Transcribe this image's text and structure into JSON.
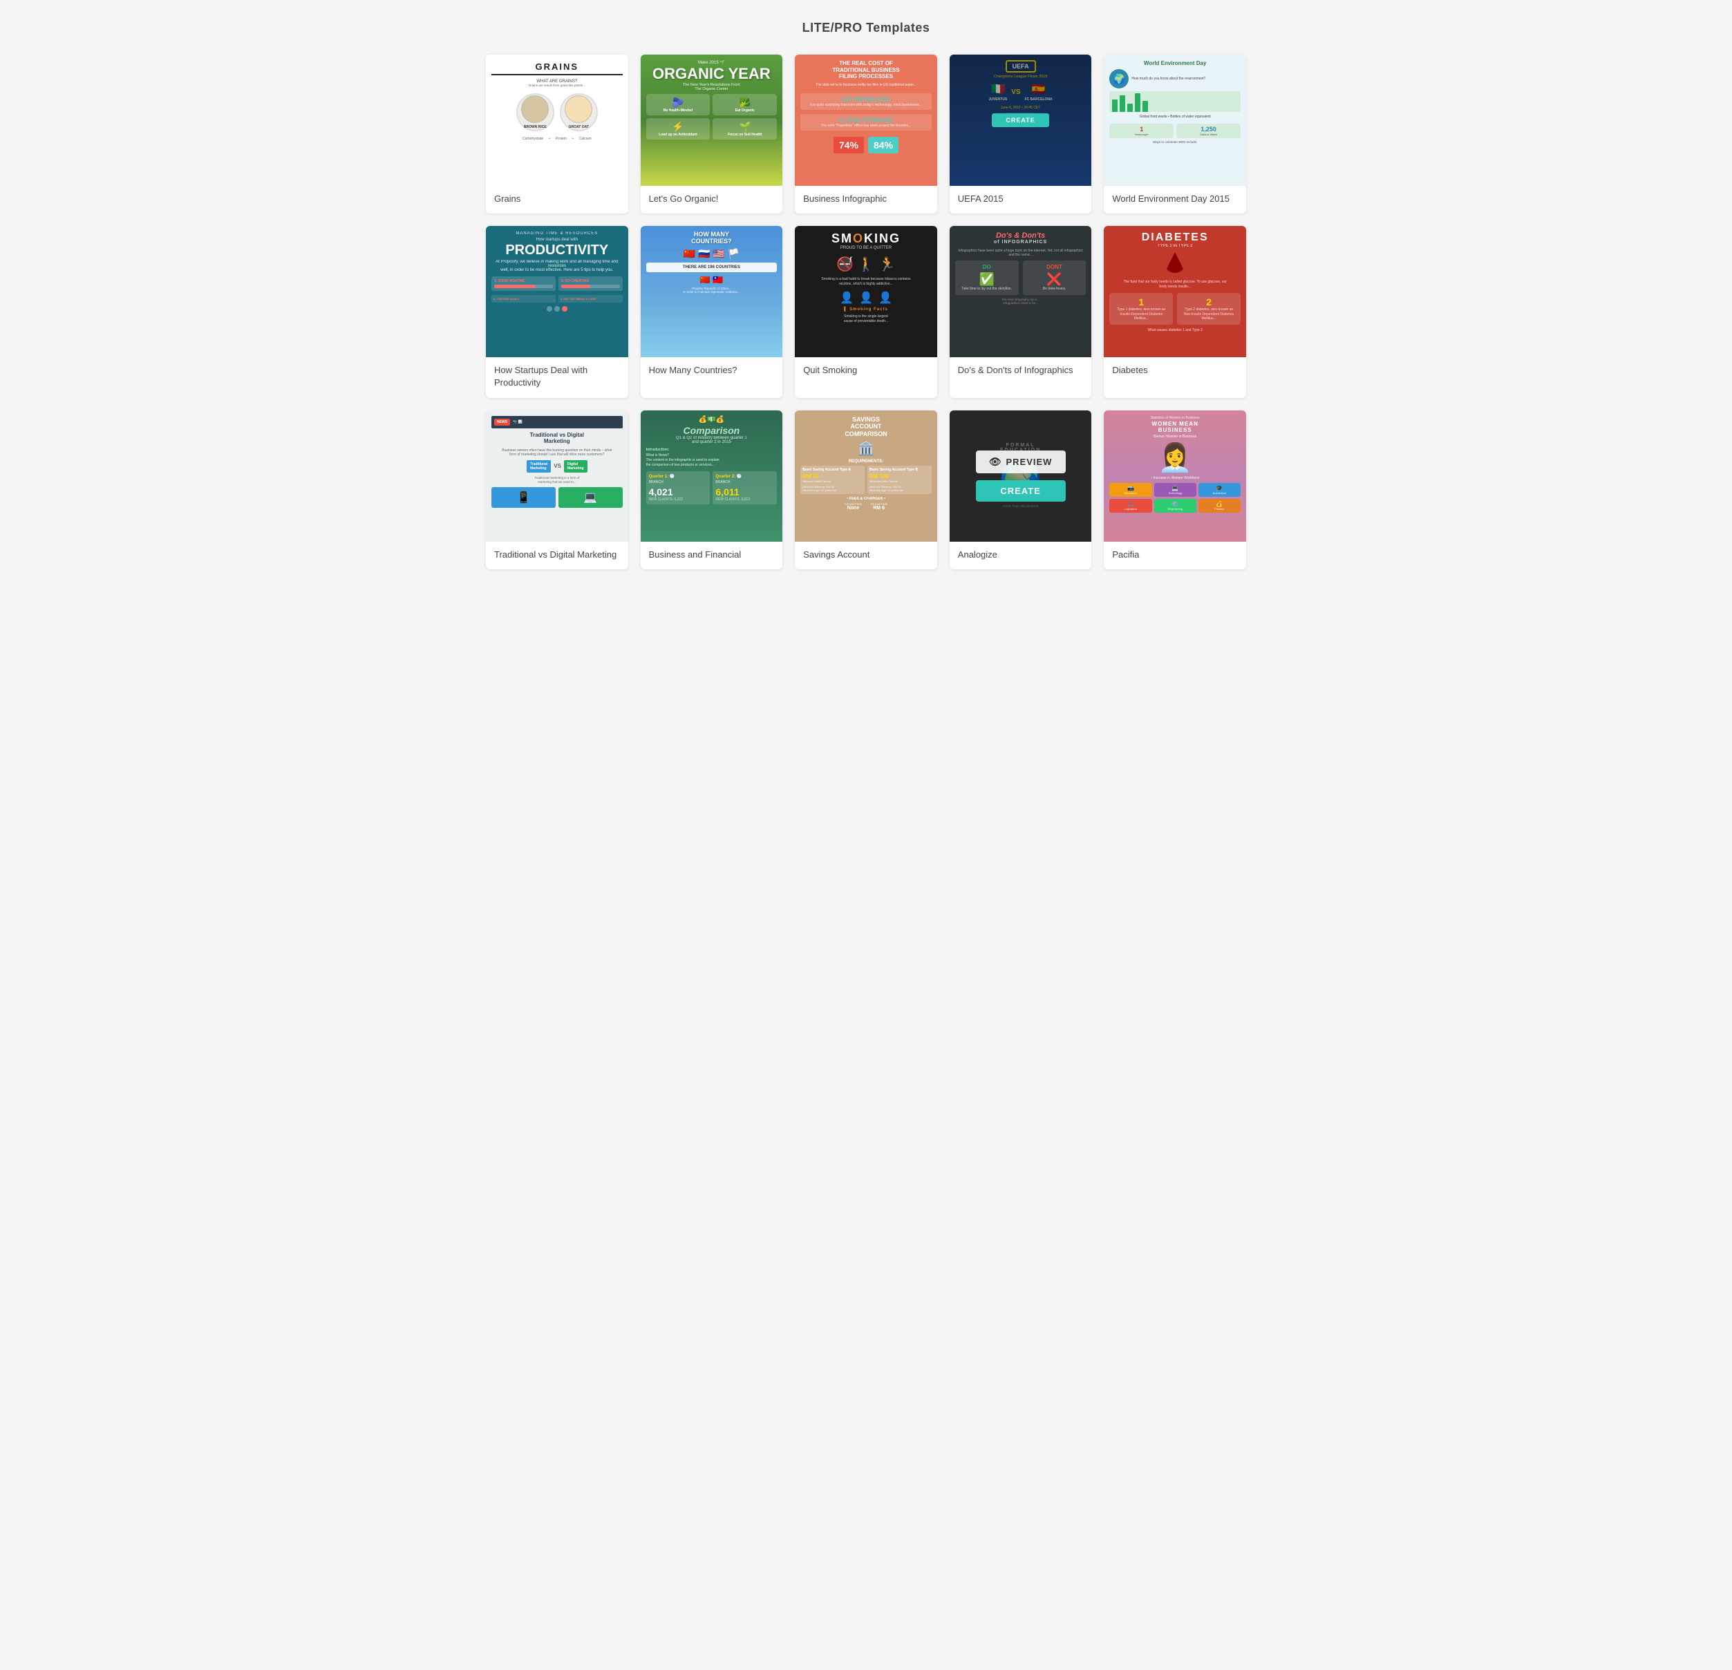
{
  "page": {
    "title": "LITE/PRO Templates"
  },
  "cards": [
    {
      "id": "grains",
      "label": "Grains",
      "show_overlay": false
    },
    {
      "id": "organic",
      "label": "Let's Go Organic!",
      "show_overlay": false
    },
    {
      "id": "business",
      "label": "Business Infographic",
      "show_overlay": false
    },
    {
      "id": "uefa",
      "label": "UEFA 2015",
      "show_overlay": true
    },
    {
      "id": "world-env",
      "label": "World Environment Day 2015",
      "show_overlay": false
    },
    {
      "id": "productivity",
      "label": "How Startups Deal with Productivity",
      "show_overlay": false
    },
    {
      "id": "countries",
      "label": "How Many Countries?",
      "show_overlay": false
    },
    {
      "id": "smoking",
      "label": "Quit Smoking",
      "show_overlay": false
    },
    {
      "id": "dos-donts",
      "label": "Do's & Don'ts of Infographics",
      "show_overlay": false
    },
    {
      "id": "diabetes",
      "label": "Diabetes",
      "show_overlay": false
    },
    {
      "id": "marketing",
      "label": "Traditional vs Digital Marketing",
      "show_overlay": false
    },
    {
      "id": "financial",
      "label": "Business and Financial",
      "show_overlay": false
    },
    {
      "id": "savings",
      "label": "Savings Account",
      "show_overlay": false
    },
    {
      "id": "analogize",
      "label": "Analogize",
      "show_overlay": true,
      "show_both": true
    },
    {
      "id": "pacifia",
      "label": "Pacifia",
      "show_overlay": false
    }
  ],
  "buttons": {
    "preview": "PREVIEW",
    "create": "CREATE"
  },
  "colors": {
    "create_bg": "#2ec4b6",
    "preview_bg": "#ffffff"
  }
}
